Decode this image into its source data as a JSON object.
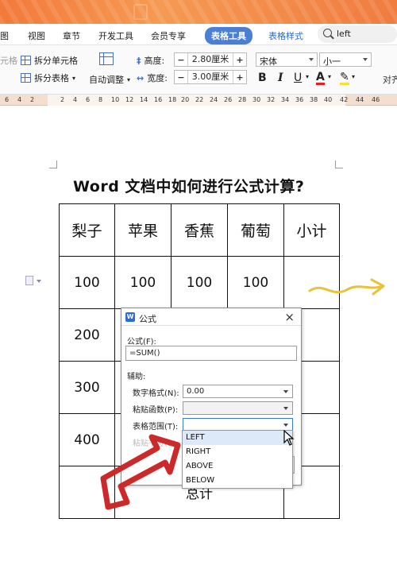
{
  "menubar": {
    "items": [
      "图",
      "视图",
      "章节",
      "开发工具",
      "会员专享"
    ],
    "active_tab": "表格工具",
    "tab2": "表格样式",
    "search_value": "left"
  },
  "toolbar": {
    "split_cell": "拆分单元格",
    "split_table": "拆分表格",
    "auto_adjust": "自动调整",
    "height_label": "高度:",
    "height_value": "2.80厘米",
    "width_label": "宽度:",
    "width_value": "3.00厘米",
    "font_name": "宋体",
    "font_size": "小一",
    "bold": "B",
    "italic": "I",
    "underline": "U",
    "font_color": "A",
    "highlight": "✎",
    "align": "对齐",
    "left_edge": "元格"
  },
  "ruler": [
    "6",
    "4",
    "2",
    "2",
    "4",
    "6",
    "8",
    "10",
    "12",
    "14",
    "16",
    "18",
    "20",
    "22",
    "24",
    "26",
    "28",
    "30",
    "32",
    "34",
    "36",
    "38",
    "40",
    "42",
    "44",
    "46"
  ],
  "document": {
    "title": "Word 文档中如何进行公式计算?",
    "headers": [
      "梨子",
      "苹果",
      "香蕉",
      "葡萄",
      "小计"
    ],
    "row1": [
      "100",
      "100",
      "100",
      "100",
      ""
    ],
    "col1": [
      "200",
      "300",
      "400"
    ],
    "total": "总计"
  },
  "dialog": {
    "title": "公式",
    "formula_label": "公式(F):",
    "formula_value": "=SUM()",
    "assist_label": "辅助:",
    "number_format_label": "数字格式(N):",
    "number_format_value": "0.00",
    "paste_function_label": "粘贴函数(P):",
    "table_range_label": "表格范围(T):",
    "bookmark_label": "粘贴书签(B):",
    "options": [
      "LEFT",
      "RIGHT",
      "ABOVE",
      "BELOW"
    ]
  },
  "colors": {
    "title_bar": "#f27a3a",
    "active_tab": "#4a7fd4",
    "annotation_red": "#cc2a2a",
    "annotation_yellow": "#e8c23a"
  }
}
